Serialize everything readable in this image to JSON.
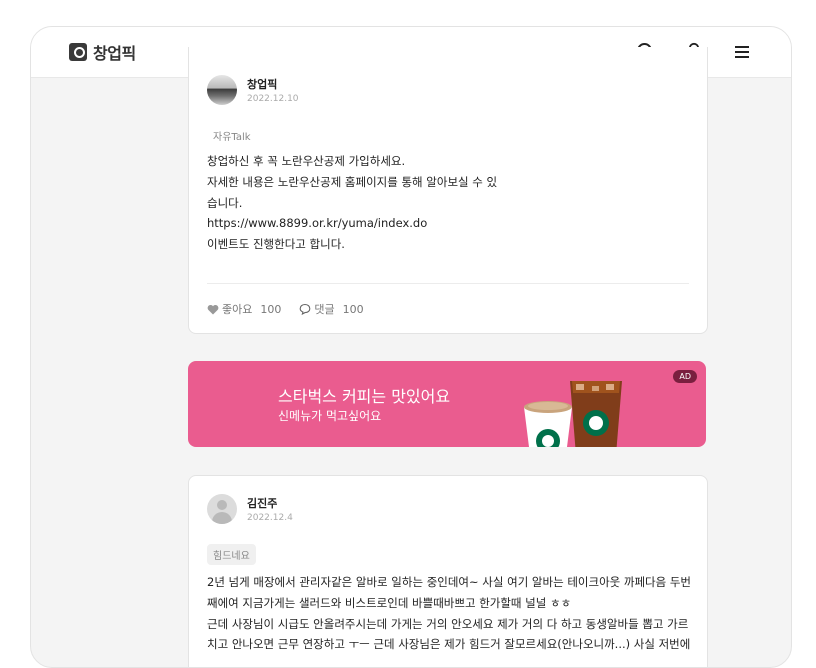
{
  "header": {
    "logo_text": "창업픽"
  },
  "posts": [
    {
      "author": "창업픽",
      "date": "2022.12.10",
      "tag": "자유Talk",
      "lines": [
        "창업하신 후 꼭 노란우산공제 가입하세요.",
        "자세한 내용은 노란우산공제 홈페이지를 통해 알아보실 수 있",
        "습니다.",
        "https://www.8899.or.kr/yuma/index.do",
        "이벤트도 진행한다고 합니다."
      ],
      "likes_label": "좋아요",
      "likes": "100",
      "comments_label": "댓글",
      "comments": "100"
    },
    {
      "author": "김진주",
      "date": "2022.12.4",
      "tag": "힘드네요",
      "lines": [
        "2년 넘게 매장에서 관리자같은 알바로 일하는 중인데여~ 사실 여기 알바는 테이크아웃 까페다음 두번",
        "째에여 지금가게는 샐러드와 비스트로인데 바쁠때바쁘고 한가할때 널널 ㅎㅎ",
        "근데 사장님이 시급도 안올려주시는데 가게는 거의 안오세요 제가 거의 다 하고 동생알바들 뽑고 가르",
        "치고 안나오면 근무 연장하고 ㅜㅡ 근데 사장님은 제가 힘드거 잘모르세요(안나오니까...) 사실 저번에"
      ]
    }
  ],
  "ad": {
    "title": "스타벅스 커피는 맛있어요",
    "subtitle": "신메뉴가 먹고싶어요",
    "badge": "AD"
  },
  "colors": {
    "ad_background": "#ea5c8f",
    "ad_badge": "#7a1f3f"
  }
}
